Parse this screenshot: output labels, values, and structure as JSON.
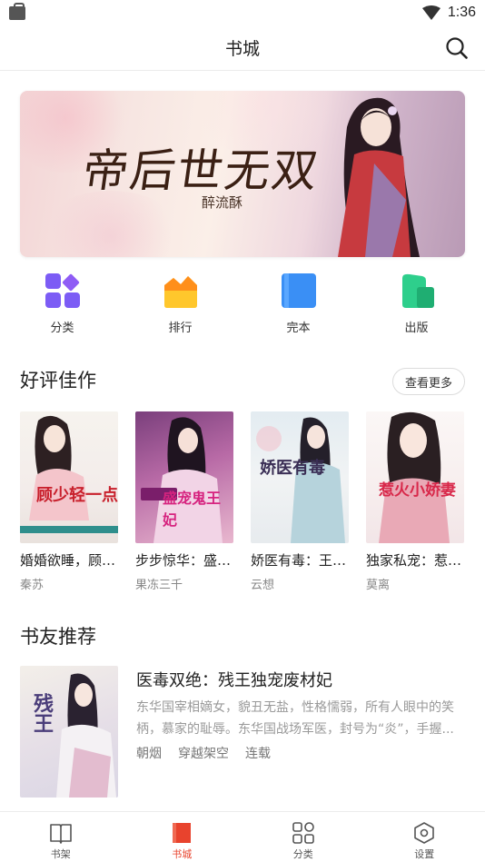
{
  "status_bar": {
    "time": "1:36"
  },
  "header": {
    "title": "书城"
  },
  "banner": {
    "title": "帝后世无双",
    "author": "醉流酥"
  },
  "categories": [
    {
      "label": "分类",
      "icon": "category-grid-icon",
      "color": "#7c5cf5"
    },
    {
      "label": "排行",
      "icon": "ranking-crown-icon",
      "color": "#ffb300"
    },
    {
      "label": "完本",
      "icon": "complete-book-icon",
      "color": "#3a8ff5"
    },
    {
      "label": "出版",
      "icon": "publish-book-icon",
      "color": "#2ecf8c"
    }
  ],
  "good_reviews": {
    "title": "好评佳作",
    "more_label": "查看更多",
    "books": [
      {
        "name": "婚婚欲睡，顾少轻一点",
        "author": "秦苏",
        "cover_text": "顾少轻一点"
      },
      {
        "name": "步步惊华：盛宠鬼王妃",
        "author": "果冻三千",
        "cover_text": "盛宠鬼王妃"
      },
      {
        "name": "娇医有毒：王爷宠妻无度",
        "author": "云想",
        "cover_text": "娇医有毒"
      },
      {
        "name": "独家私宠：惹火小娇妻",
        "author": "莫离",
        "cover_text": "惹火小娇妻"
      }
    ]
  },
  "friends_recommend": {
    "title": "书友推荐",
    "book": {
      "name": "医毒双绝：残王独宠废材妃",
      "desc": "东华国宰相嫡女，貌丑无盐，性格懦弱，所有人眼中的笑柄，慕家的耻辱。东华国战场军医，封号为“炎”，手握...",
      "author": "朝烟",
      "tag": "穿越架空",
      "status": "连载",
      "cover_text": "残王"
    }
  },
  "bottom_nav": [
    {
      "label": "书架",
      "icon": "bookshelf-icon",
      "active": false
    },
    {
      "label": "书城",
      "icon": "bookstore-icon",
      "active": true
    },
    {
      "label": "分类",
      "icon": "category-icon",
      "active": false
    },
    {
      "label": "设置",
      "icon": "settings-icon",
      "active": false
    }
  ],
  "colors": {
    "accent": "#e8432d",
    "divider": "#ececec",
    "muted": "#999999"
  }
}
